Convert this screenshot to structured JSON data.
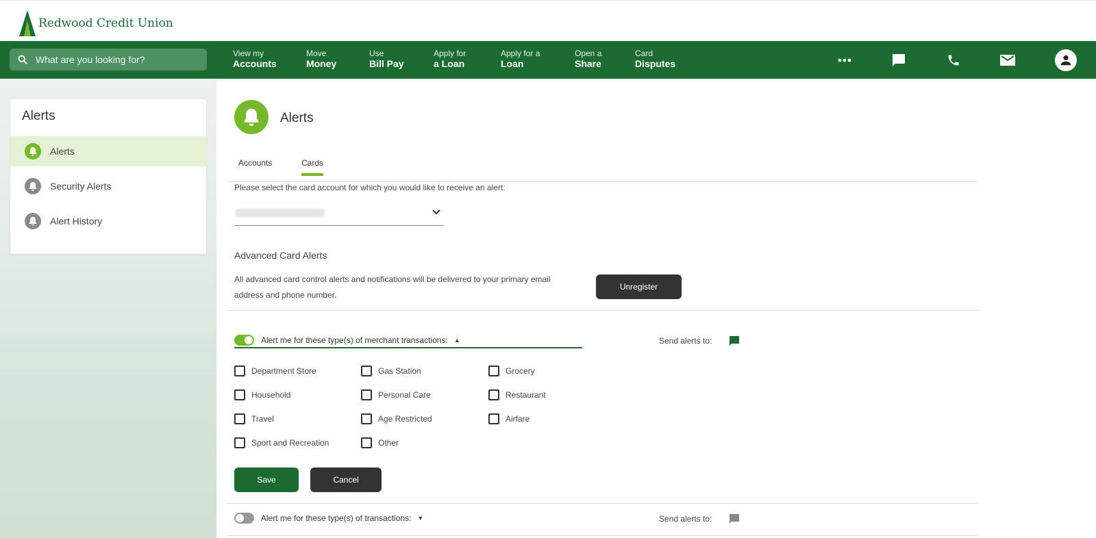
{
  "brand": {
    "name": "Redwood Credit Union",
    "color": "#1b6b33",
    "accent": "#75b82a"
  },
  "search": {
    "placeholder": "What are you looking for?",
    "icon": "search-icon"
  },
  "nav": [
    {
      "line1": "View my",
      "line2": "Accounts"
    },
    {
      "line1": "Move",
      "line2": "Money"
    },
    {
      "line1": "Use",
      "line2": "Bill Pay"
    },
    {
      "line1": "Apply for",
      "line2": "a Loan"
    },
    {
      "line1": "Apply for a",
      "line2": "Loan"
    },
    {
      "line1": "Open a",
      "line2": "Share"
    },
    {
      "line1": "Card",
      "line2": "Disputes"
    }
  ],
  "nav_icons": [
    "more-icon",
    "chat-icon",
    "phone-icon",
    "mail-icon",
    "profile-icon"
  ],
  "sidebar": {
    "title": "Alerts",
    "items": [
      {
        "label": "Alerts",
        "active": true
      },
      {
        "label": "Security Alerts",
        "active": false
      },
      {
        "label": "Alert History",
        "active": false
      }
    ]
  },
  "main": {
    "title": "Alerts",
    "tabs": [
      {
        "label": "Accounts",
        "active": false
      },
      {
        "label": "Cards",
        "active": true
      }
    ],
    "instruction": "Please select the card account for which you would like to receive an alert:",
    "advanced": {
      "title": "Advanced Card Alerts",
      "description": "All advanced card control alerts and notifications will be delivered to your primary email address and phone number.",
      "unregister_label": "Unregister"
    },
    "merchant": {
      "toggle_on": true,
      "label": "Alert me for these type(s) of merchant transactions:",
      "send_label": "Send alerts to:",
      "categories": [
        "Department Store",
        "Gas Station",
        "Grocery",
        "Household",
        "Personal Care",
        "Restaurant",
        "Travel",
        "Age Restricted",
        "Airfare",
        "Sport and Recreation",
        "Other"
      ],
      "save_label": "Save",
      "cancel_label": "Cancel"
    },
    "transactions": {
      "toggle_on": false,
      "label": "Alert me for these type(s) of transactions:",
      "send_label": "Send alerts to:"
    }
  }
}
